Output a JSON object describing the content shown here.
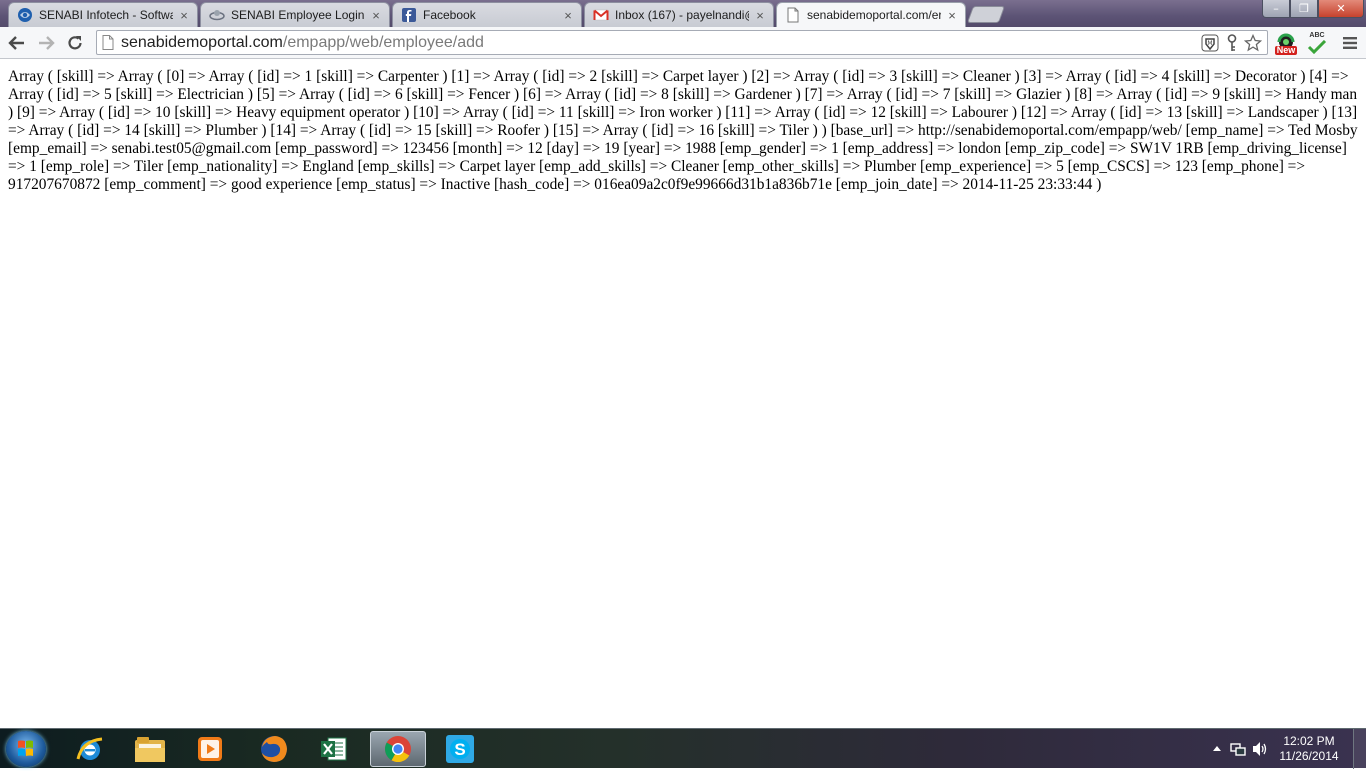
{
  "browser": {
    "tabs": [
      {
        "title": "SENABI Infotech - Softwar",
        "icon": "senabi-globe-icon",
        "active": false
      },
      {
        "title": "SENABI Employee Login",
        "icon": "page-loading-icon",
        "active": false
      },
      {
        "title": "Facebook",
        "icon": "facebook-icon",
        "active": false
      },
      {
        "title": "Inbox (167) - payelnandi@",
        "icon": "gmail-icon",
        "active": false
      },
      {
        "title": "senabidemoportal.com/er",
        "icon": "page-icon",
        "active": true
      }
    ],
    "close_glyph": "×",
    "window_controls": {
      "minimize": "–",
      "maximize": "❐",
      "close": "✕"
    },
    "address": {
      "host": "senabidemoportal.com",
      "path": "/empapp/web/employee/add"
    },
    "extension_badge": "New",
    "extension_abc": "ABC"
  },
  "page": {
    "output_text": "Array ( [skill] => Array ( [0] => Array ( [id] => 1 [skill] => Carpenter ) [1] => Array ( [id] => 2 [skill] => Carpet layer ) [2] => Array ( [id] => 3 [skill] => Cleaner ) [3] => Array ( [id] => 4 [skill] => Decorator ) [4] => Array ( [id] => 5 [skill] => Electrician ) [5] => Array ( [id] => 6 [skill] => Fencer ) [6] => Array ( [id] => 8 [skill] => Gardener ) [7] => Array ( [id] => 7 [skill] => Glazier ) [8] => Array ( [id] => 9 [skill] => Handy man ) [9] => Array ( [id] => 10 [skill] => Heavy equipment operator ) [10] => Array ( [id] => 11 [skill] => Iron worker ) [11] => Array ( [id] => 12 [skill] => Labourer ) [12] => Array ( [id] => 13 [skill] => Landscaper ) [13] => Array ( [id] => 14 [skill] => Plumber ) [14] => Array ( [id] => 15 [skill] => Roofer ) [15] => Array ( [id] => 16 [skill] => Tiler ) ) [base_url] => http://senabidemoportal.com/empapp/web/ [emp_name] => Ted Mosby [emp_email] => senabi.test05@gmail.com [emp_password] => 123456 [month] => 12 [day] => 19 [year] => 1988 [emp_gender] => 1 [emp_address] => london [emp_zip_code] => SW1V 1RB [emp_driving_license] => 1 [emp_role] => Tiler [emp_nationality] => England [emp_skills] => Carpet layer [emp_add_skills] => Cleaner [emp_other_skills] => Plumber [emp_experience] => 5 [emp_CSCS] => 123 [emp_phone] => 917207670872 [emp_comment] => good experience [emp_status] => Inactive [hash_code] => 016ea09a2c0f9e99666d31b1a836b71e [emp_join_date] => 2014-11-25 23:33:44 )"
  },
  "taskbar": {
    "apps": [
      {
        "name": "internet-explorer-icon",
        "active": false
      },
      {
        "name": "file-explorer-icon",
        "active": false
      },
      {
        "name": "media-player-icon",
        "active": false
      },
      {
        "name": "firefox-icon",
        "active": false
      },
      {
        "name": "excel-icon",
        "active": false
      },
      {
        "name": "chrome-icon",
        "active": true
      },
      {
        "name": "skype-icon",
        "active": false
      }
    ],
    "clock": {
      "time": "12:02 PM",
      "date": "11/26/2014"
    }
  },
  "colors": {
    "titlebar": "#5c5375",
    "tab_active": "#f6f7f9",
    "page_bg": "#ffffff",
    "gmail_red": "#d93025",
    "facebook_blue": "#3b5998"
  }
}
